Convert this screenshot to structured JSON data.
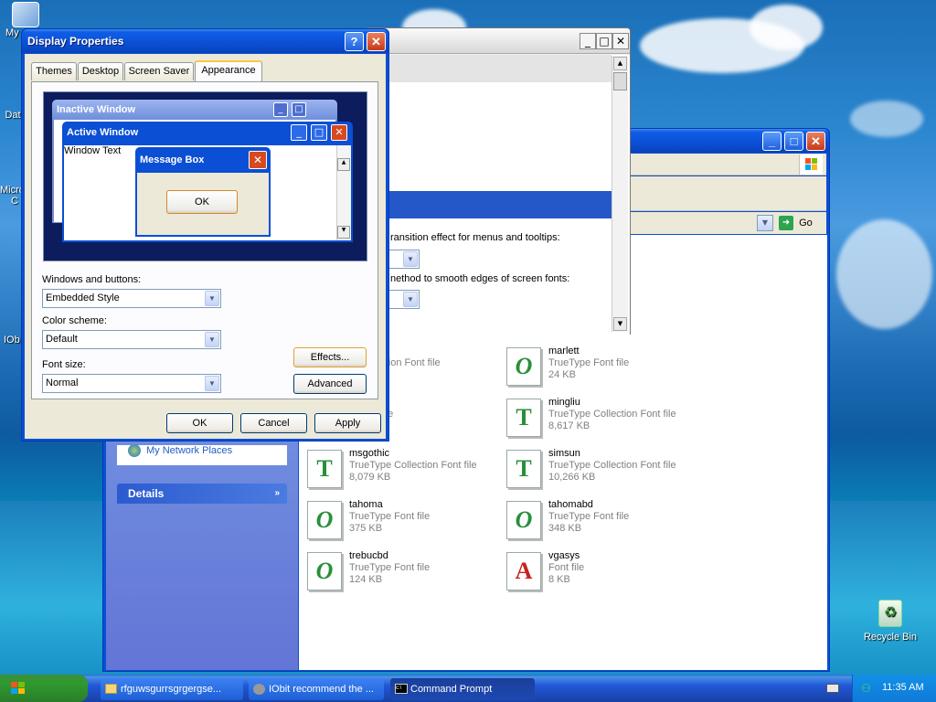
{
  "desktop": {
    "icons": [
      {
        "label": "My",
        "name": "desktop-icon-my-computer"
      },
      {
        "label": "Dat",
        "name": "desktop-icon-dat"
      },
      {
        "label": "Micro",
        "name": "desktop-icon-micro"
      },
      {
        "label": "C",
        "name": "desktop-icon-c"
      },
      {
        "label": "IOb",
        "name": "desktop-icon-iobit"
      }
    ],
    "recycle_bin": "Recycle Bin"
  },
  "display_properties": {
    "title": "Display Properties",
    "help": "?",
    "close": "✕",
    "tabs": [
      "Themes",
      "Desktop",
      "Screen Saver",
      "Appearance"
    ],
    "preview": {
      "inactive_title": "Inactive Window",
      "active_title": "Active Window",
      "window_text": "Window Text",
      "message_box_title": "Message Box",
      "ok": "OK"
    },
    "windows_buttons_label": "Windows and buttons:",
    "windows_buttons_value": "Embedded Style",
    "color_scheme_label": "Color scheme:",
    "color_scheme_value": "Default",
    "font_size_label": "Font size:",
    "font_size_value": "Normal",
    "effects_button": "Effects...",
    "advanced_button": "Advanced",
    "ok_button": "OK",
    "cancel_button": "Cancel",
    "apply_button": "Apply"
  },
  "effects_window": {
    "line1": "ransition effect for menus and tooltips:",
    "line2": "nethod to smooth edges of screen fonts:"
  },
  "explorer": {
    "go_label": "Go",
    "sidebar_link": "My Network Places",
    "details_label": "Details",
    "files": [
      {
        "name": "",
        "type": "e Collection Font file",
        "size": "KB",
        "icon": "O"
      },
      {
        "name": "",
        "type": "e Font file",
        "size": "",
        "icon": "T"
      },
      {
        "name": "msgothic",
        "type": "TrueType Collection Font file",
        "size": "8,079 KB",
        "icon": "T"
      },
      {
        "name": "tahoma",
        "type": "TrueType Font file",
        "size": "375 KB",
        "icon": "O"
      },
      {
        "name": "trebucbd",
        "type": "TrueType Font file",
        "size": "124 KB",
        "icon": "O"
      },
      {
        "name": "marlett",
        "type": "TrueType Font file",
        "size": "24 KB",
        "icon": "O"
      },
      {
        "name": "mingliu",
        "type": "TrueType Collection Font file",
        "size": "8,617 KB",
        "icon": "T"
      },
      {
        "name": "simsun",
        "type": "TrueType Collection Font file",
        "size": "10,266 KB",
        "icon": "T"
      },
      {
        "name": "tahomabd",
        "type": "TrueType Font file",
        "size": "348 KB",
        "icon": "O"
      },
      {
        "name": "vgasys",
        "type": "Font file",
        "size": "8 KB",
        "icon": "A"
      }
    ]
  },
  "taskbar": {
    "tasks": [
      "rfguwsgurrsgrgergse...",
      "IObit recommend the ...",
      "Command Prompt"
    ],
    "clock": "11:35 AM"
  }
}
